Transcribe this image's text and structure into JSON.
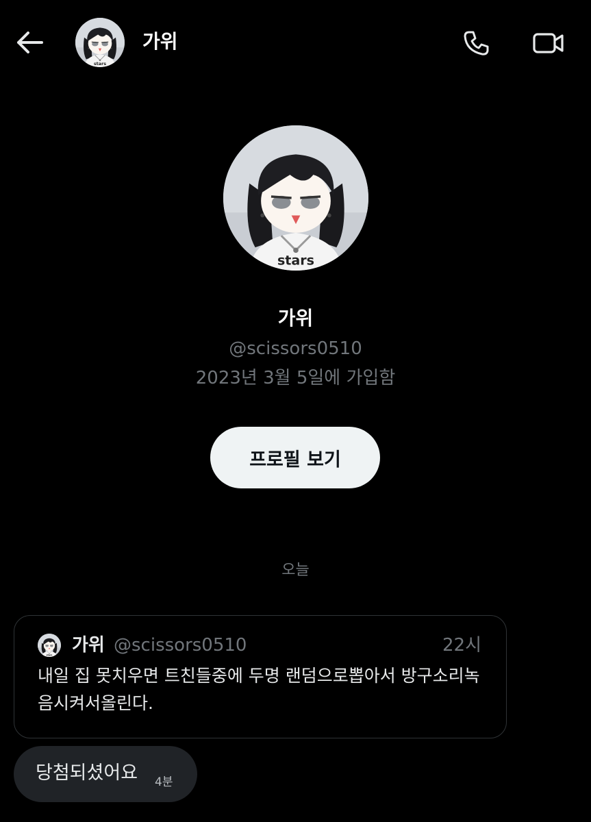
{
  "header": {
    "back_icon": "arrow-left-icon",
    "name": "가위",
    "call_icon": "phone-icon",
    "video_icon": "video-camera-icon"
  },
  "profile": {
    "name": "가위",
    "handle": "@scissors0510",
    "joined": "2023년 3월 5일에 가입함",
    "view_profile_label": "프로필 보기",
    "avatar_shirt_text": "stars"
  },
  "conversation": {
    "date_divider": "오늘",
    "shared_tweet": {
      "author": "가위",
      "handle": "@scissors0510",
      "time": "22시",
      "text": "내일 집 못치우면 트친들중에 두명 랜덤으로뽑아서 방구소리녹음시켜서올린다."
    },
    "message": {
      "text": "당첨되셨어요",
      "time": "4분"
    }
  },
  "colors": {
    "background": "#000000",
    "primary_text": "#e7e9ea",
    "secondary_text": "#71767b",
    "button_bg": "#eff3f4",
    "bubble_bg": "#202327",
    "card_border": "#2f3336"
  }
}
